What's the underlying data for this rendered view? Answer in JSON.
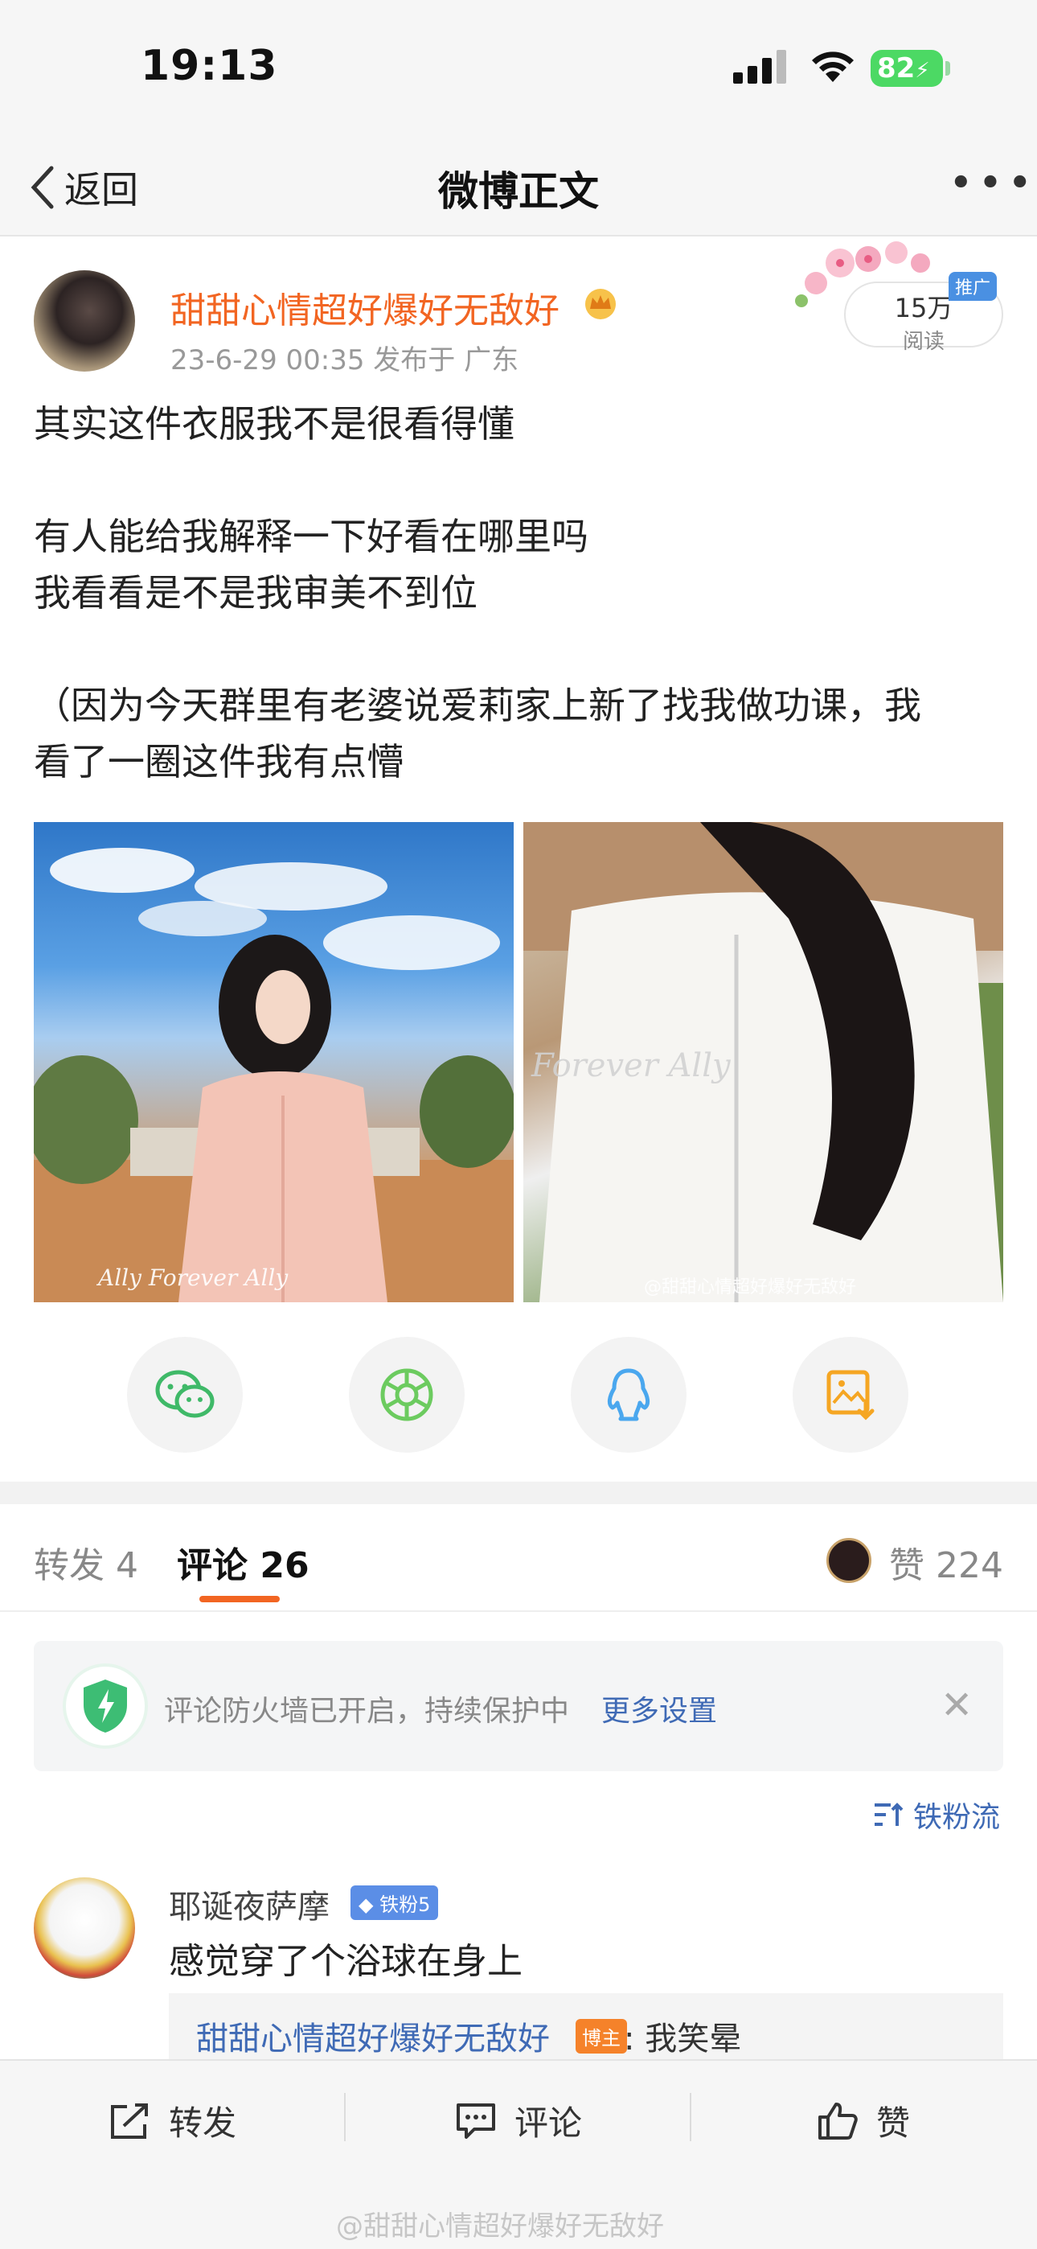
{
  "status_bar": {
    "time": "19:13",
    "battery": "82"
  },
  "nav": {
    "back_label": "返回",
    "title": "微博正文"
  },
  "post": {
    "author": "甜甜心情超好爆好无敌好",
    "meta": "23-6-29 00:35  发布于 广东",
    "reads_count": "15万",
    "reads_label": "阅读",
    "promo_badge": "推广",
    "lines": [
      "其实这件衣服我不是很看得懂",
      "有人能给我解释一下好看在哪里吗",
      "我看看是不是我审美不到位",
      "（因为今天群里有老婆说爱莉家上新了找我做功课，我",
      "看了一圈这件我有点懵"
    ],
    "image1_watermark": "Ally Forever Ally",
    "image2_watermark": "Forever Ally",
    "image2_credit": "@甜甜心情超好爆好无敌好"
  },
  "share_icons": [
    "wechat-icon",
    "moments-icon",
    "qq-icon",
    "save-image-icon"
  ],
  "tabs": {
    "repost_label": "转发",
    "repost_count": "4",
    "comment_label": "评论",
    "comment_count": "26",
    "like_label": "赞",
    "like_count": "224"
  },
  "firewall": {
    "text": "评论防火墙已开启，持续保护中",
    "link": "更多设置"
  },
  "sort_label": "铁粉流",
  "comments": [
    {
      "name": "耶诞夜萨摩",
      "badge": "铁粉5",
      "text": "感觉穿了个浴球在身上",
      "reply": {
        "name": "甜甜心情超好爆好无敌好",
        "badge": "博主",
        "text": ": 我笑晕"
      }
    }
  ],
  "bottom_bar": {
    "repost": "转发",
    "comment": "评论",
    "like": "赞"
  },
  "footer_watermark": "@甜甜心情超好爆好无敌好",
  "colors": {
    "accent": "#f26522",
    "link": "#3f6ab5",
    "fan_badge": "#5b8ee6",
    "host_badge": "#f5822a"
  }
}
